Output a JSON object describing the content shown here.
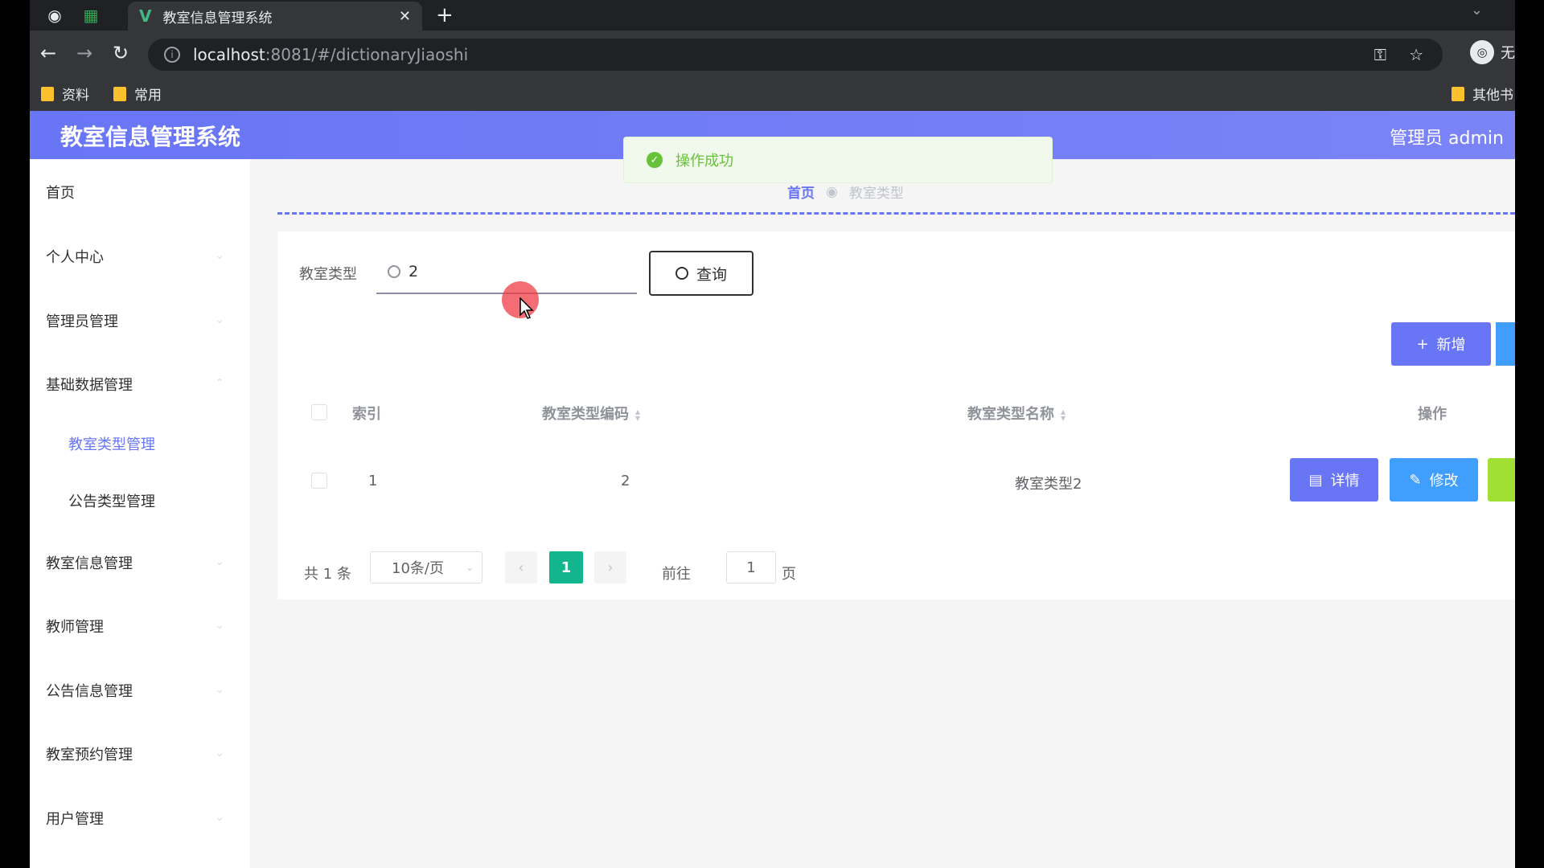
{
  "browser": {
    "tab_title": "教室信息管理系统",
    "tab_favicon": "V",
    "url_host": "localhost",
    "url_rest": ":8081/#/dictionaryJiaoshi",
    "bookmarks": [
      {
        "label": "资料",
        "icon": "folder-icon"
      },
      {
        "label": "常用",
        "icon": "folder-icon"
      },
      {
        "label": "其他书",
        "icon": "folder-icon"
      }
    ],
    "profile_label": "无"
  },
  "app": {
    "title": "教室信息管理系统",
    "user_label": "管理员 admin",
    "accent_color": "#6875f5"
  },
  "toast": {
    "message": "操作成功",
    "type": "success"
  },
  "breadcrumb": {
    "home": "首页",
    "current": "教室类型"
  },
  "sidebar": {
    "items": [
      {
        "label": "首页"
      },
      {
        "label": "个人中心"
      },
      {
        "label": "管理员管理"
      },
      {
        "label": "基础数据管理"
      },
      {
        "label": "教室类型管理",
        "active": true
      },
      {
        "label": "公告类型管理"
      },
      {
        "label": "教室信息管理"
      },
      {
        "label": "教师管理"
      },
      {
        "label": "公告信息管理"
      },
      {
        "label": "教室预约管理"
      },
      {
        "label": "用户管理"
      }
    ]
  },
  "search": {
    "label": "教室类型",
    "value": "2",
    "button_label": "查询"
  },
  "actions": {
    "add_label": "新增"
  },
  "table": {
    "columns": [
      "索引",
      "教室类型编码",
      "教室类型名称",
      "操作"
    ],
    "rows": [
      {
        "index": "1",
        "code": "2",
        "name": "教室类型2"
      }
    ],
    "row_actions": {
      "detail": "详情",
      "edit": "修改"
    }
  },
  "pagination": {
    "total_text": "共 1 条",
    "page_size": "10条/页",
    "current_page": "1",
    "goto_label": "前往",
    "goto_value": "1",
    "goto_unit": "页"
  }
}
